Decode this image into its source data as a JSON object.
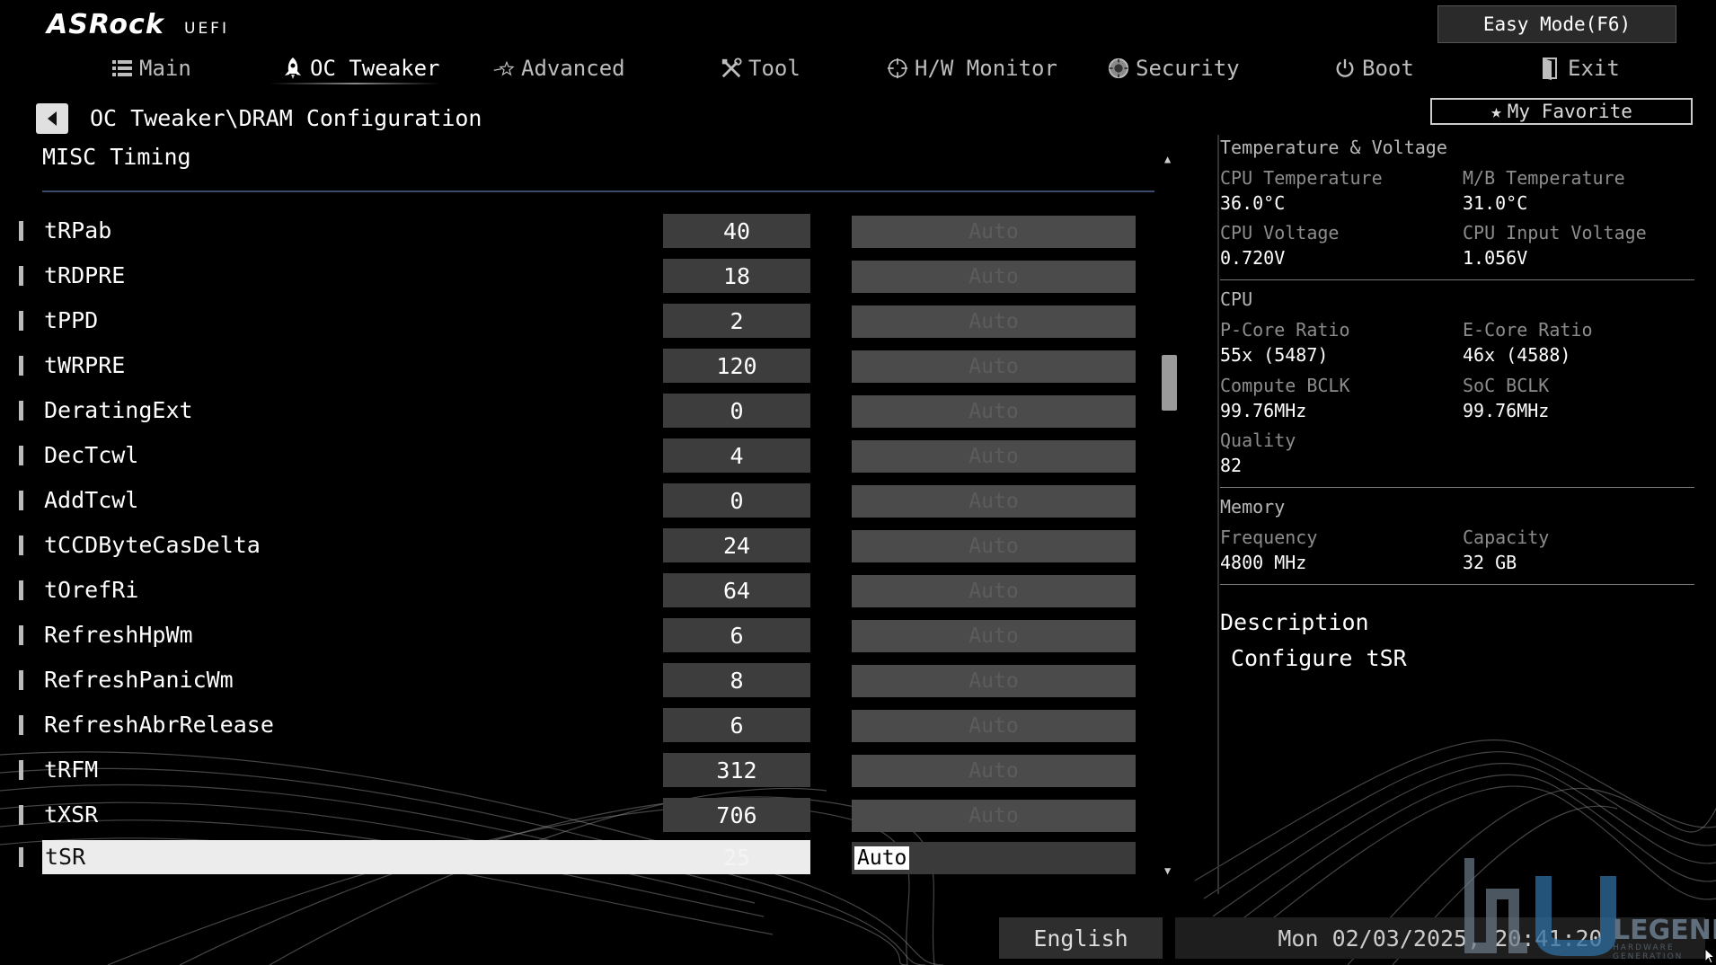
{
  "app": {
    "brand": "ASRock",
    "brand_sub": "UEFI",
    "easy_mode_label": "Easy Mode(F6)"
  },
  "tabs": [
    {
      "label": "Main",
      "icon": "list-icon",
      "active": false
    },
    {
      "label": "OC Tweaker",
      "icon": "rocket-icon",
      "active": true
    },
    {
      "label": "Advanced",
      "icon": "star-icon",
      "active": false
    },
    {
      "label": "Tool",
      "icon": "tools-icon",
      "active": false
    },
    {
      "label": "H/W Monitor",
      "icon": "crosshair-icon",
      "active": false
    },
    {
      "label": "Security",
      "icon": "shield-icon",
      "active": false
    },
    {
      "label": "Boot",
      "icon": "power-icon",
      "active": false
    },
    {
      "label": "Exit",
      "icon": "exit-icon",
      "active": false
    }
  ],
  "breadcrumb": "OC Tweaker\\DRAM Configuration",
  "favorite_label": "My Favorite",
  "section_title": "MISC Timing",
  "rows": [
    {
      "label": "tRPab",
      "value": "40",
      "setting": "Auto"
    },
    {
      "label": "tRDPRE",
      "value": "18",
      "setting": "Auto"
    },
    {
      "label": "tPPD",
      "value": "2",
      "setting": "Auto"
    },
    {
      "label": "tWRPRE",
      "value": "120",
      "setting": "Auto"
    },
    {
      "label": "DeratingExt",
      "value": "0",
      "setting": "Auto"
    },
    {
      "label": "DecTcwl",
      "value": "4",
      "setting": "Auto"
    },
    {
      "label": "AddTcwl",
      "value": "0",
      "setting": "Auto"
    },
    {
      "label": "tCCDByteCasDelta",
      "value": "24",
      "setting": "Auto"
    },
    {
      "label": "tOrefRi",
      "value": "64",
      "setting": "Auto"
    },
    {
      "label": "RefreshHpWm",
      "value": "6",
      "setting": "Auto"
    },
    {
      "label": "RefreshPanicWm",
      "value": "8",
      "setting": "Auto"
    },
    {
      "label": "RefreshAbrRelease",
      "value": "6",
      "setting": "Auto"
    },
    {
      "label": "tRFM",
      "value": "312",
      "setting": "Auto"
    },
    {
      "label": "tXSR",
      "value": "706",
      "setting": "Auto"
    },
    {
      "label": "tSR",
      "value": "25",
      "setting": "Auto",
      "selected": true
    }
  ],
  "status_panel": {
    "temp_voltage_heading": "Temperature & Voltage",
    "cpu_temp_label": "CPU Temperature",
    "cpu_temp": "36.0°C",
    "mb_temp_label": "M/B Temperature",
    "mb_temp": "31.0°C",
    "cpu_voltage_label": "CPU Voltage",
    "cpu_voltage": "0.720V",
    "cpu_input_voltage_label": "CPU Input Voltage",
    "cpu_input_voltage": "1.056V",
    "cpu_heading": "CPU",
    "pcore_label": "P-Core Ratio",
    "pcore": "55x (5487)",
    "ecore_label": "E-Core Ratio",
    "ecore": "46x (4588)",
    "compute_bclk_label": "Compute BCLK",
    "compute_bclk": "99.76MHz",
    "soc_bclk_label": "SoC BCLK",
    "soc_bclk": "99.76MHz",
    "quality_label": "Quality",
    "quality": "82",
    "memory_heading": "Memory",
    "frequency_label": "Frequency",
    "frequency": "4800 MHz",
    "capacity_label": "Capacity",
    "capacity": "32 GB"
  },
  "description": {
    "heading": "Description",
    "text": "Configure tSR"
  },
  "footer": {
    "language": "English",
    "datetime": "Mon 02/03/2025, 20:41:20"
  },
  "watermark": {
    "text": "LEGEND",
    "sub": "HARDWARE GENERATION"
  },
  "colors": {
    "background": "#000000",
    "highlight": "#ececec",
    "value_box": "#3d3d3d",
    "auto_box": "#4b4b4b"
  }
}
